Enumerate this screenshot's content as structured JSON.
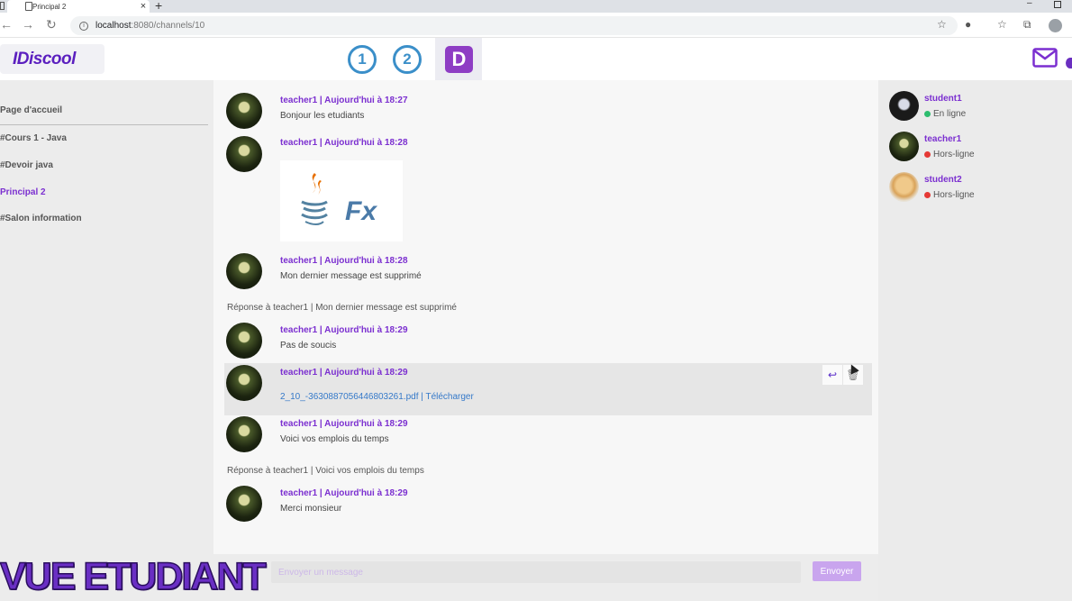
{
  "browser": {
    "tab_title": "Principal 2",
    "tab_close": "×",
    "new_tab": "+",
    "url_host": "localhost",
    "url_path": ":8080/channels/10",
    "window_min": "–"
  },
  "header": {
    "logo": "IDiscool",
    "servers": [
      "1",
      "2",
      "D"
    ]
  },
  "sidebar": {
    "items": [
      {
        "label": "Page d'accueil",
        "active": false
      },
      {
        "label": "#Cours 1 - Java",
        "active": false
      },
      {
        "label": "#Devoir java",
        "active": false
      },
      {
        "label": "Principal 2",
        "active": true
      },
      {
        "label": "#Salon information",
        "active": false
      }
    ]
  },
  "messages": [
    {
      "author": "teacher1 | Aujourd'hui à 18:27",
      "text": "Bonjour les etudiants"
    },
    {
      "author": "teacher1 | Aujourd'hui à 18:28",
      "image_caption": "Fx"
    },
    {
      "author": "teacher1 | Aujourd'hui à 18:28",
      "text": "Mon dernier message est supprimé"
    },
    {
      "reply": "Réponse à teacher1 | Mon dernier message est supprimé"
    },
    {
      "author": "teacher1 | Aujourd'hui à 18:29",
      "text": "Pas de soucis"
    },
    {
      "author": "teacher1 | Aujourd'hui à 18:29",
      "file": "2_10_-3630887056446803261.pdf | Télécharger"
    },
    {
      "author": "teacher1 | Aujourd'hui à 18:29",
      "text": "Voici vos emplois du temps"
    },
    {
      "reply": "Réponse à teacher1 | Voici vos emplois du temps"
    },
    {
      "author": "teacher1 | Aujourd'hui à 18:29",
      "text": "Merci monsieur"
    }
  ],
  "composer": {
    "placeholder": "Envoyer un message",
    "send_label": "Envoyer"
  },
  "members": [
    {
      "name": "student1",
      "status": "En ligne",
      "status_color": "#2dbd6e"
    },
    {
      "name": "teacher1",
      "status": "Hors-ligne",
      "status_color": "#e53935"
    },
    {
      "name": "student2",
      "status": "Hors-ligne",
      "status_color": "#e53935"
    }
  ],
  "caption": "VUE ETUDIANT",
  "colors": {
    "accent": "#7b2fd0",
    "link": "#3579c9",
    "server_blue": "#3b8fc9",
    "server_d": "#8e3dc4"
  }
}
